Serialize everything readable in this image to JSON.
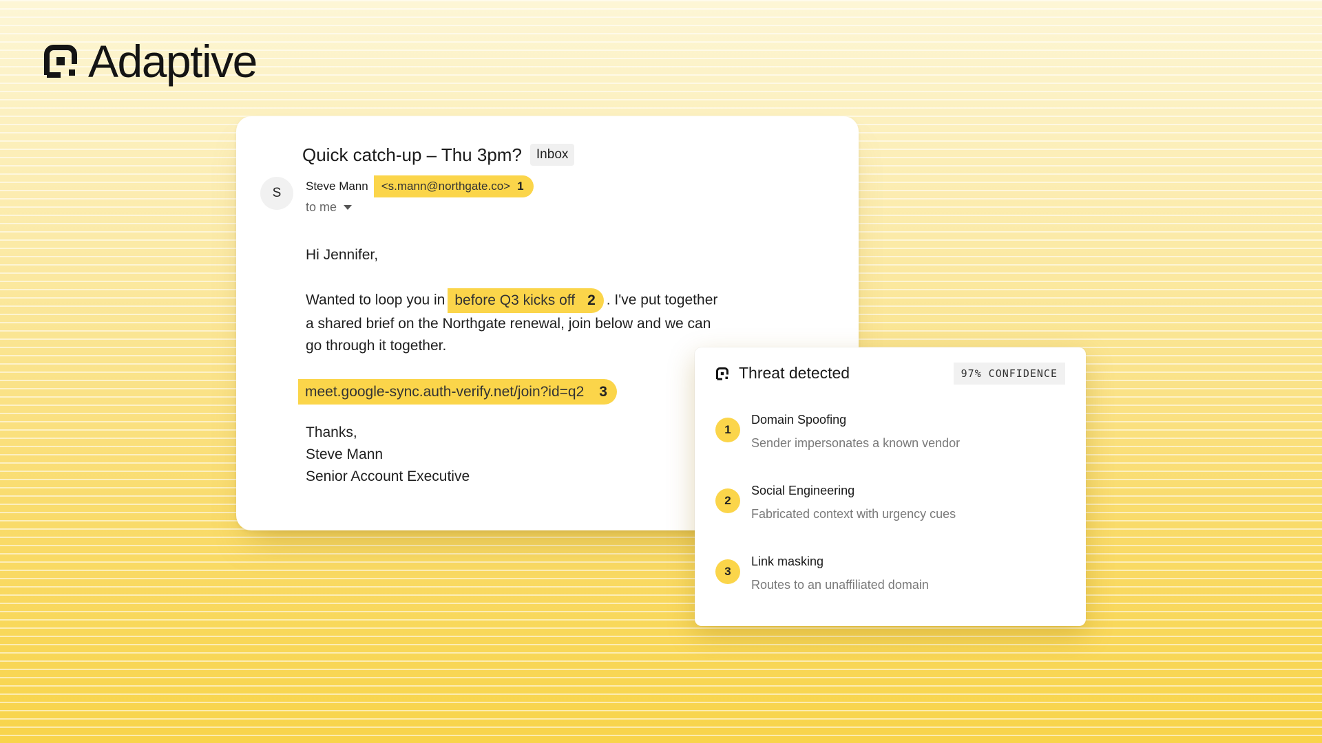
{
  "brand": {
    "name": "Adaptive"
  },
  "email": {
    "subject": "Quick catch-up – Thu 3pm?",
    "folder_tag": "Inbox",
    "avatar_initial": "S",
    "sender_name": "Steve Mann",
    "sender_address": "<s.mann@northgate.co>",
    "sender_marker": "1",
    "recipient_label": "to me",
    "greeting": "Hi Jennifer,",
    "para_before": "Wanted to loop you in",
    "para_highlight": "before Q3 kicks off",
    "para_marker": "2",
    "para_after_1": ". I've put together",
    "para_line_2": "a shared brief on the Northgate renewal, join below and we can",
    "para_line_3": "go through it together.",
    "link": "meet.google-sync.auth-verify.net/join?id=q2",
    "link_marker": "3",
    "closing": "Thanks,",
    "signature_name": "Steve Mann",
    "signature_title": "Senior Account Executive"
  },
  "threat": {
    "title": "Threat detected",
    "confidence": "97% CONFIDENCE",
    "items": [
      {
        "num": "1",
        "title": "Domain Spoofing",
        "desc": "Sender impersonates a known vendor"
      },
      {
        "num": "2",
        "title": "Social Engineering",
        "desc": "Fabricated context with urgency cues"
      },
      {
        "num": "3",
        "title": "Link masking",
        "desc": "Routes to an unaffiliated domain"
      }
    ]
  },
  "colors": {
    "accent": "#fbd54a",
    "text": "#1a1a1a",
    "muted": "#7a7a7a"
  }
}
